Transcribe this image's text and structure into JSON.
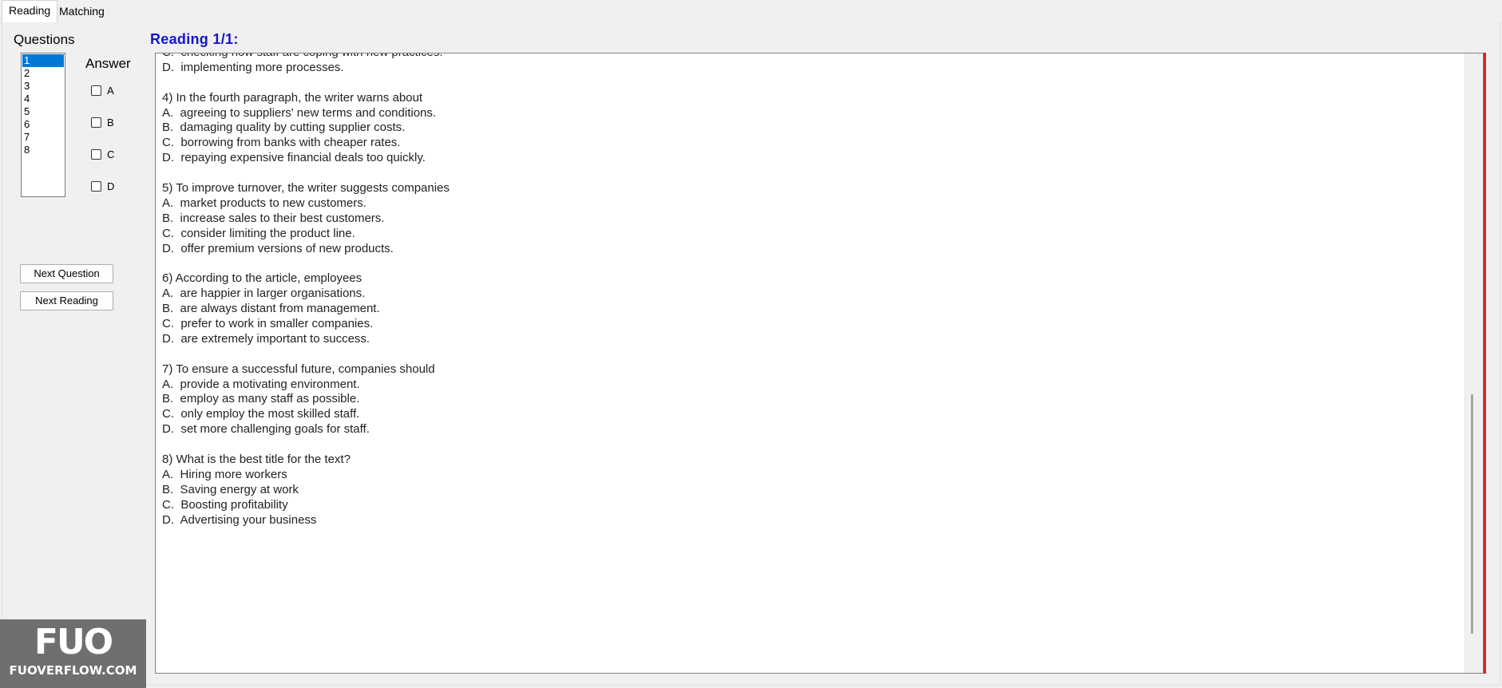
{
  "tabs": [
    {
      "label": "Reading",
      "active": true
    },
    {
      "label": "Matching",
      "active": false
    }
  ],
  "left_panel": {
    "questions_label": "Questions",
    "answer_label": "Answer",
    "question_numbers": [
      "1",
      "2",
      "3",
      "4",
      "5",
      "6",
      "7",
      "8"
    ],
    "selected_question": "1",
    "answer_options": [
      "A",
      "B",
      "C",
      "D"
    ],
    "next_question_label": "Next Question",
    "next_reading_label": "Next Reading"
  },
  "reading": {
    "title": "Reading 1/1:",
    "lines": [
      "C.  checking how staff are coping with new practices.",
      "D.  implementing more processes.",
      "",
      "4) In the fourth paragraph, the writer warns about",
      "A.  agreeing to suppliers' new terms and conditions.",
      "B.  damaging quality by cutting supplier costs.",
      "C.  borrowing from banks with cheaper rates.",
      "D.  repaying expensive financial deals too quickly.",
      "",
      "5) To improve turnover, the writer suggests companies",
      "A.  market products to new customers.",
      "B.  increase sales to their best customers.",
      "C.  consider limiting the product line.",
      "D.  offer premium versions of new products.",
      "",
      "6) According to the article, employees",
      "A.  are happier in larger organisations.",
      "B.  are always distant from management.",
      "C.  prefer to work in smaller companies.",
      "D.  are extremely important to success.",
      "",
      "7) To ensure a successful future, companies should",
      "A.  provide a motivating environment.",
      "B.  employ as many staff as possible.",
      "C.  only employ the most skilled staff.",
      "D.  set more challenging goals for staff.",
      "",
      "8) What is the best title for the text?",
      "A.  Hiring more workers",
      "B.  Saving energy at work",
      "C.  Boosting profitability",
      "D.  Advertising your business"
    ]
  },
  "watermark": {
    "logo": "FUO",
    "site": "FUOVERFLOW.COM"
  },
  "colors": {
    "accent_blue": "#1414d0",
    "selection": "#0078d7",
    "red_border": "#e31b1b"
  }
}
